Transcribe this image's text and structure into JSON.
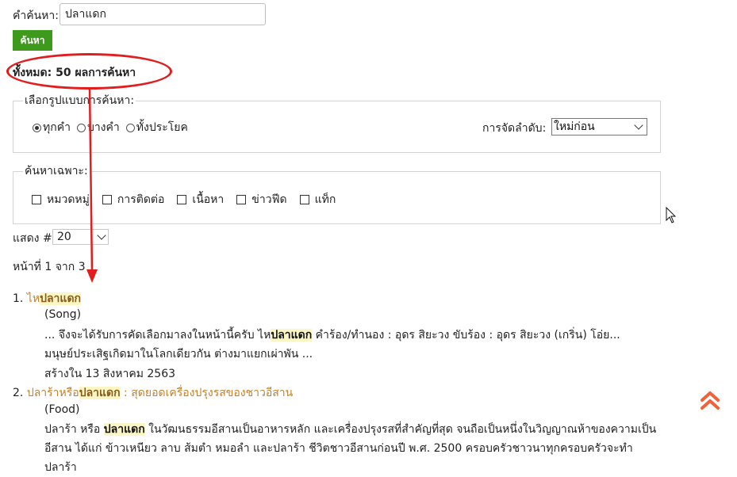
{
  "search": {
    "label": "คำค้นหา:",
    "query": "ปลาแดก",
    "button": "ค้นหา"
  },
  "summary": {
    "total_text": "ทั้งหมด: 50 ผลการค้นหา"
  },
  "search_mode": {
    "legend": "เลือกรูปแบบการค้นหา:",
    "options": [
      "ทุกคำ",
      "บางคำ",
      "ทั้งประโยค"
    ],
    "selected": "ทุกคำ",
    "sort_label": "การจัดลำดับ:",
    "sort_value": "ใหม่ก่อน"
  },
  "filters": {
    "legend": "ค้นหาเฉพาะ:",
    "items": [
      "หมวดหมู่",
      "การติดต่อ",
      "เนื้อหา",
      "ข่าวฟีด",
      "แท็ก"
    ]
  },
  "per_page": {
    "label": "แสดง #",
    "value": "20"
  },
  "pagination": {
    "text": "หน้าที่ 1 จาก 3"
  },
  "results": [
    {
      "number": "1.",
      "title_pre": "ไห",
      "title_hl": "ปลาแดก",
      "title_post": "",
      "category": "(Song)",
      "snippet_1": "... จึงจะได้รับการคัดเลือกมาลงในหน้านี้ครับ   ไห",
      "snippet_hl": "ปลาแดก",
      "snippet_2": " คำร้อง/ทำนอง : อุดร สิยะวง ขับร้อง : อุดร สิยะวง               (เกริ่น) โอ่ย...",
      "snippet_3": "มนุษย์ประเสิฐเกิดมาในโลกเดียวกัน ต่างมาแยกเผ่าพัน ...",
      "date": "สร้างใน 13 สิงหาคม 2563"
    },
    {
      "number": "2.",
      "title_pre": "ปลาร้าหรือ",
      "title_hl": "ปลาแดก",
      "title_post": " : สุดยอดเครื่องปรุงรสของชาวอีสาน",
      "category": "(Food)",
      "snippet_1": "ปลาร้า หรือ ",
      "snippet_hl": "ปลาแดก",
      "snippet_2": " ในวัฒนธรรมอีสานเป็นอาหารหลัก และเครื่องปรุงรสที่สำคัญที่สุด จนถือเป็นหนึ่งในวิญญาณห้าของความเป็น",
      "snippet_3": "อีสาน ได้แก่ ข้าวเหนียว ลาบ ส้มตำ หมอลำ และปลาร้า ชีวิตชาวอีสานก่อนปี พ.ศ. 2500 ครอบครัวชาวนาทุกครอบครัวจะทำปลาร้า"
    }
  ],
  "icons": {
    "scroll_top": "double-chevron-up-icon",
    "cursor": "mouse-pointer-icon"
  },
  "colors": {
    "button_green": "#3e9a1c",
    "title_orange": "#c4812a",
    "highlight_bg": "#fbf6c4",
    "annotation_red": "#e01e1e",
    "scroll_top_icon": "#f0623a"
  }
}
